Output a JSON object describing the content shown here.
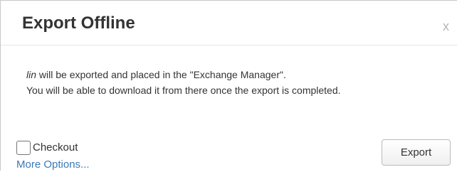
{
  "dialog": {
    "title": "Export Offline",
    "close_label": "x",
    "message": {
      "item_name": "lin",
      "line1_rest": " will be exported and placed in the \"Exchange Manager\".",
      "line2": "You will be able to download it from there once the export is completed."
    },
    "checkout": {
      "label": "Checkout",
      "checked": false
    },
    "more_options_label": "More Options...",
    "export_label": "Export"
  },
  "colors": {
    "title_text": "#333333",
    "link": "#3a7ab8",
    "close_icon": "#b5b5b5"
  }
}
